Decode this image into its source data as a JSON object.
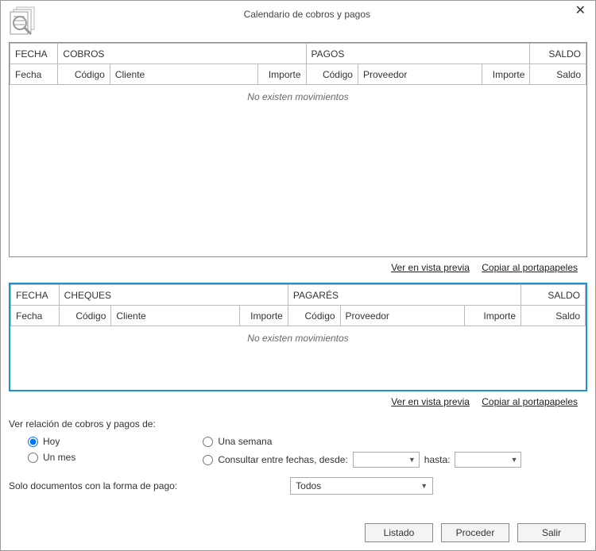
{
  "window": {
    "title": "Calendario de cobros y pagos",
    "close_glyph": "✕"
  },
  "table1": {
    "group_fecha": "FECHA",
    "group_cobros": "COBROS",
    "group_pagos": "PAGOS",
    "group_saldo": "SALDO",
    "h_fecha": "Fecha",
    "h_codigo1": "Código",
    "h_cliente": "Cliente",
    "h_importe1": "Importe",
    "h_codigo2": "Código",
    "h_proveedor": "Proveedor",
    "h_importe2": "Importe",
    "h_saldo": "Saldo",
    "empty": "No existen movimientos",
    "link_preview": "Ver en vista previa",
    "link_copy": "Copiar al portapapeles"
  },
  "table2": {
    "group_fecha": "FECHA",
    "group_cheques": "CHEQUES",
    "group_pagares": "PAGARÉS",
    "group_saldo": "SALDO",
    "h_fecha": "Fecha",
    "h_codigo1": "Código",
    "h_cliente": "Cliente",
    "h_importe1": "Importe",
    "h_codigo2": "Código",
    "h_proveedor": "Proveedor",
    "h_importe2": "Importe",
    "h_saldo": "Saldo",
    "empty": "No existen movimientos",
    "link_preview": "Ver en vista previa",
    "link_copy": "Copiar al portapapeles"
  },
  "filters": {
    "heading": "Ver relación de cobros y pagos de:",
    "opt_hoy": "Hoy",
    "opt_unmes": "Un mes",
    "opt_semana": "Una semana",
    "opt_entre": "Consultar entre fechas, desde:",
    "lbl_hasta": "hasta:",
    "payform_label": "Solo documentos con la forma de pago:",
    "payform_value": "Todos"
  },
  "buttons": {
    "listado": "Listado",
    "proceder": "Proceder",
    "salir": "Salir"
  }
}
